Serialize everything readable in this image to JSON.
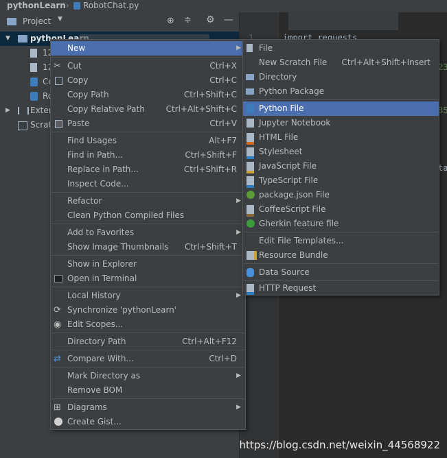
{
  "breadcrumb": {
    "project": "pythonLearn",
    "file": "RobotChat.py"
  },
  "project_panel": {
    "title": "Project",
    "root": "pythonLearn",
    "children": [
      "12",
      "12",
      "Co",
      "Ro"
    ],
    "external": "Exter",
    "scratches": "Scrat"
  },
  "editor": {
    "line_number": "1",
    "code_line": "import requests",
    "fragments": [
      "23",
      "35",
      "ta"
    ]
  },
  "context_menu": {
    "new": "New",
    "cut": "Cut",
    "cut_sc": "Ctrl+X",
    "copy": "Copy",
    "copy_sc": "Ctrl+C",
    "copy_path": "Copy Path",
    "copy_path_sc": "Ctrl+Shift+C",
    "copy_rel": "Copy Relative Path",
    "copy_rel_sc": "Ctrl+Alt+Shift+C",
    "paste": "Paste",
    "paste_sc": "Ctrl+V",
    "find_usages": "Find Usages",
    "find_usages_sc": "Alt+F7",
    "find_in_path": "Find in Path...",
    "find_in_path_sc": "Ctrl+Shift+F",
    "replace_in_path": "Replace in Path...",
    "replace_in_path_sc": "Ctrl+Shift+R",
    "inspect": "Inspect Code...",
    "refactor": "Refactor",
    "clean": "Clean Python Compiled Files",
    "add_fav": "Add to Favorites",
    "thumbs": "Show Image Thumbnails",
    "thumbs_sc": "Ctrl+Shift+T",
    "explorer": "Show in Explorer",
    "terminal": "Open in Terminal",
    "history": "Local History",
    "sync": "Synchronize 'pythonLearn'",
    "scopes": "Edit Scopes...",
    "dir_path": "Directory Path",
    "dir_path_sc": "Ctrl+Alt+F12",
    "compare": "Compare With...",
    "compare_sc": "Ctrl+D",
    "mark_dir": "Mark Directory as",
    "remove_bom": "Remove BOM",
    "diagrams": "Diagrams",
    "gist": "Create Gist..."
  },
  "new_submenu": {
    "file": "File",
    "scratch": "New Scratch File",
    "scratch_sc": "Ctrl+Alt+Shift+Insert",
    "directory": "Directory",
    "package": "Python Package",
    "python_file": "Python File",
    "jupyter": "Jupyter Notebook",
    "html": "HTML File",
    "stylesheet": "Stylesheet",
    "js": "JavaScript File",
    "ts": "TypeScript File",
    "packagejson": "package.json File",
    "coffee": "CoffeeScript File",
    "gherkin": "Gherkin feature file",
    "templates": "Edit File Templates...",
    "bundle": "Resource Bundle",
    "datasource": "Data Source",
    "http": "HTTP Request"
  },
  "watermark": "https://blog.csdn.net/weixin_44568922",
  "colors": {
    "selection": "#4b6eaf",
    "menu_bg": "#3c3f41",
    "editor_bg": "#2b2b2b"
  }
}
